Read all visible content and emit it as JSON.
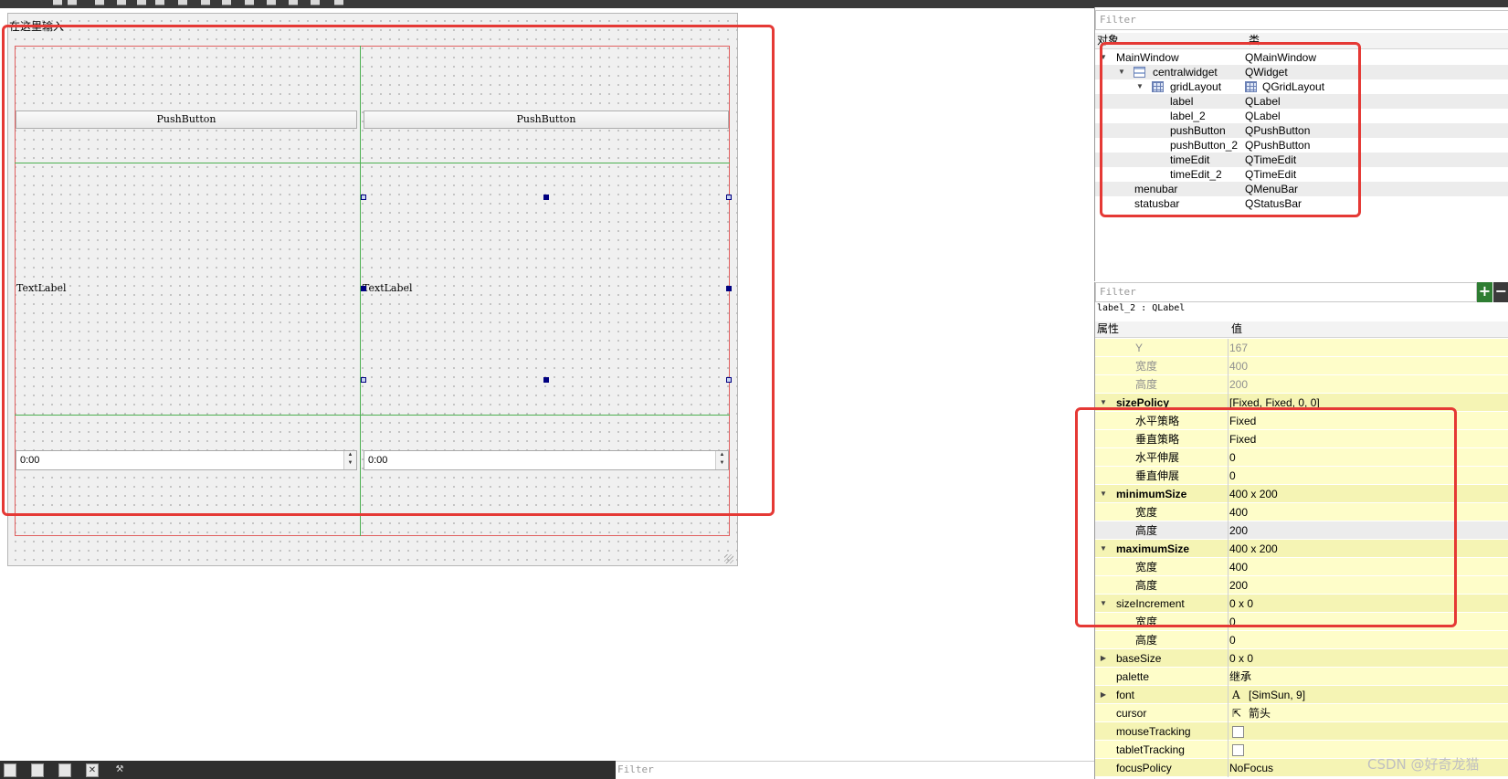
{
  "menu": {
    "type_here": "在这里输入"
  },
  "widgets": {
    "push_button_1": "PushButton",
    "push_button_2": "PushButton",
    "text_label_1": "TextLabel",
    "text_label_2": "TextLabel",
    "time_edit_1": "0:00",
    "time_edit_2": "0:00"
  },
  "object_inspector": {
    "filter_placeholder": "Filter",
    "col_object": "对象",
    "col_class": "类",
    "rows": [
      {
        "name": "MainWindow",
        "cls": "QMainWindow"
      },
      {
        "name": "centralwidget",
        "cls": "QWidget"
      },
      {
        "name": "gridLayout",
        "cls": "QGridLayout"
      },
      {
        "name": "label",
        "cls": "QLabel"
      },
      {
        "name": "label_2",
        "cls": "QLabel"
      },
      {
        "name": "pushButton",
        "cls": "QPushButton"
      },
      {
        "name": "pushButton_2",
        "cls": "QPushButton"
      },
      {
        "name": "timeEdit",
        "cls": "QTimeEdit"
      },
      {
        "name": "timeEdit_2",
        "cls": "QTimeEdit"
      },
      {
        "name": "menubar",
        "cls": "QMenuBar"
      },
      {
        "name": "statusbar",
        "cls": "QStatusBar"
      }
    ]
  },
  "property_editor": {
    "filter_placeholder": "Filter",
    "add_label": "+",
    "remove_label": "−",
    "title": "label_2 : QLabel",
    "col_property": "属性",
    "col_value": "值",
    "rows": [
      {
        "name": "Y",
        "value": "167"
      },
      {
        "name": "宽度",
        "value": "400"
      },
      {
        "name": "高度",
        "value": "200"
      },
      {
        "name": "sizePolicy",
        "value": "[Fixed, Fixed, 0, 0]"
      },
      {
        "name": "水平策略",
        "value": "Fixed"
      },
      {
        "name": "垂直策略",
        "value": "Fixed"
      },
      {
        "name": "水平伸展",
        "value": "0"
      },
      {
        "name": "垂直伸展",
        "value": "0"
      },
      {
        "name": "minimumSize",
        "value": "400 x 200"
      },
      {
        "name": "宽度",
        "value": "400"
      },
      {
        "name": "高度",
        "value": "200"
      },
      {
        "name": "maximumSize",
        "value": "400 x 200"
      },
      {
        "name": "宽度",
        "value": "400"
      },
      {
        "name": "高度",
        "value": "200"
      },
      {
        "name": "sizeIncrement",
        "value": "0 x 0"
      },
      {
        "name": "宽度",
        "value": "0"
      },
      {
        "name": "高度",
        "value": "0"
      },
      {
        "name": "baseSize",
        "value": "0 x 0"
      },
      {
        "name": "palette",
        "value": "继承"
      },
      {
        "name": "font",
        "value": "[SimSun, 9]"
      },
      {
        "name": "cursor",
        "value": "箭头"
      },
      {
        "name": "mouseTracking",
        "value": ""
      },
      {
        "name": "tabletTracking",
        "value": ""
      },
      {
        "name": "focusPolicy",
        "value": "NoFocus"
      }
    ]
  },
  "bottom": {
    "filter_placeholder": "Filter"
  },
  "watermark": "CSDN @好奇龙猫",
  "icons": {
    "font_prefix": "A",
    "cursor_prefix": "⇱"
  }
}
